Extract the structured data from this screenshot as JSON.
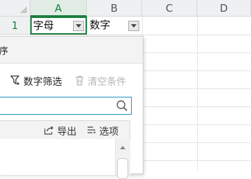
{
  "sheet": {
    "columns": [
      "A",
      "B",
      "C",
      "D"
    ],
    "active_column": "A",
    "rows": [
      "1"
    ],
    "cells": {
      "A1": "字母",
      "B1": "数字"
    }
  },
  "filter_panel": {
    "title_fragment": "序",
    "number_filter_label": "数字筛选",
    "clear_conditions_label": "清空条件",
    "search": {
      "value": "",
      "placeholder": ""
    },
    "export_label": "导出",
    "options_label": "选项"
  },
  "colors": {
    "accent_green": "#1a7f3c",
    "search_border": "#1f8fbf",
    "disabled_text": "#b5b5b5"
  },
  "icons": {
    "number_filter": "funnel-icon",
    "clear_conditions": "trash-icon",
    "search": "magnifier-icon",
    "export": "export-icon",
    "options": "options-lines-icon"
  }
}
